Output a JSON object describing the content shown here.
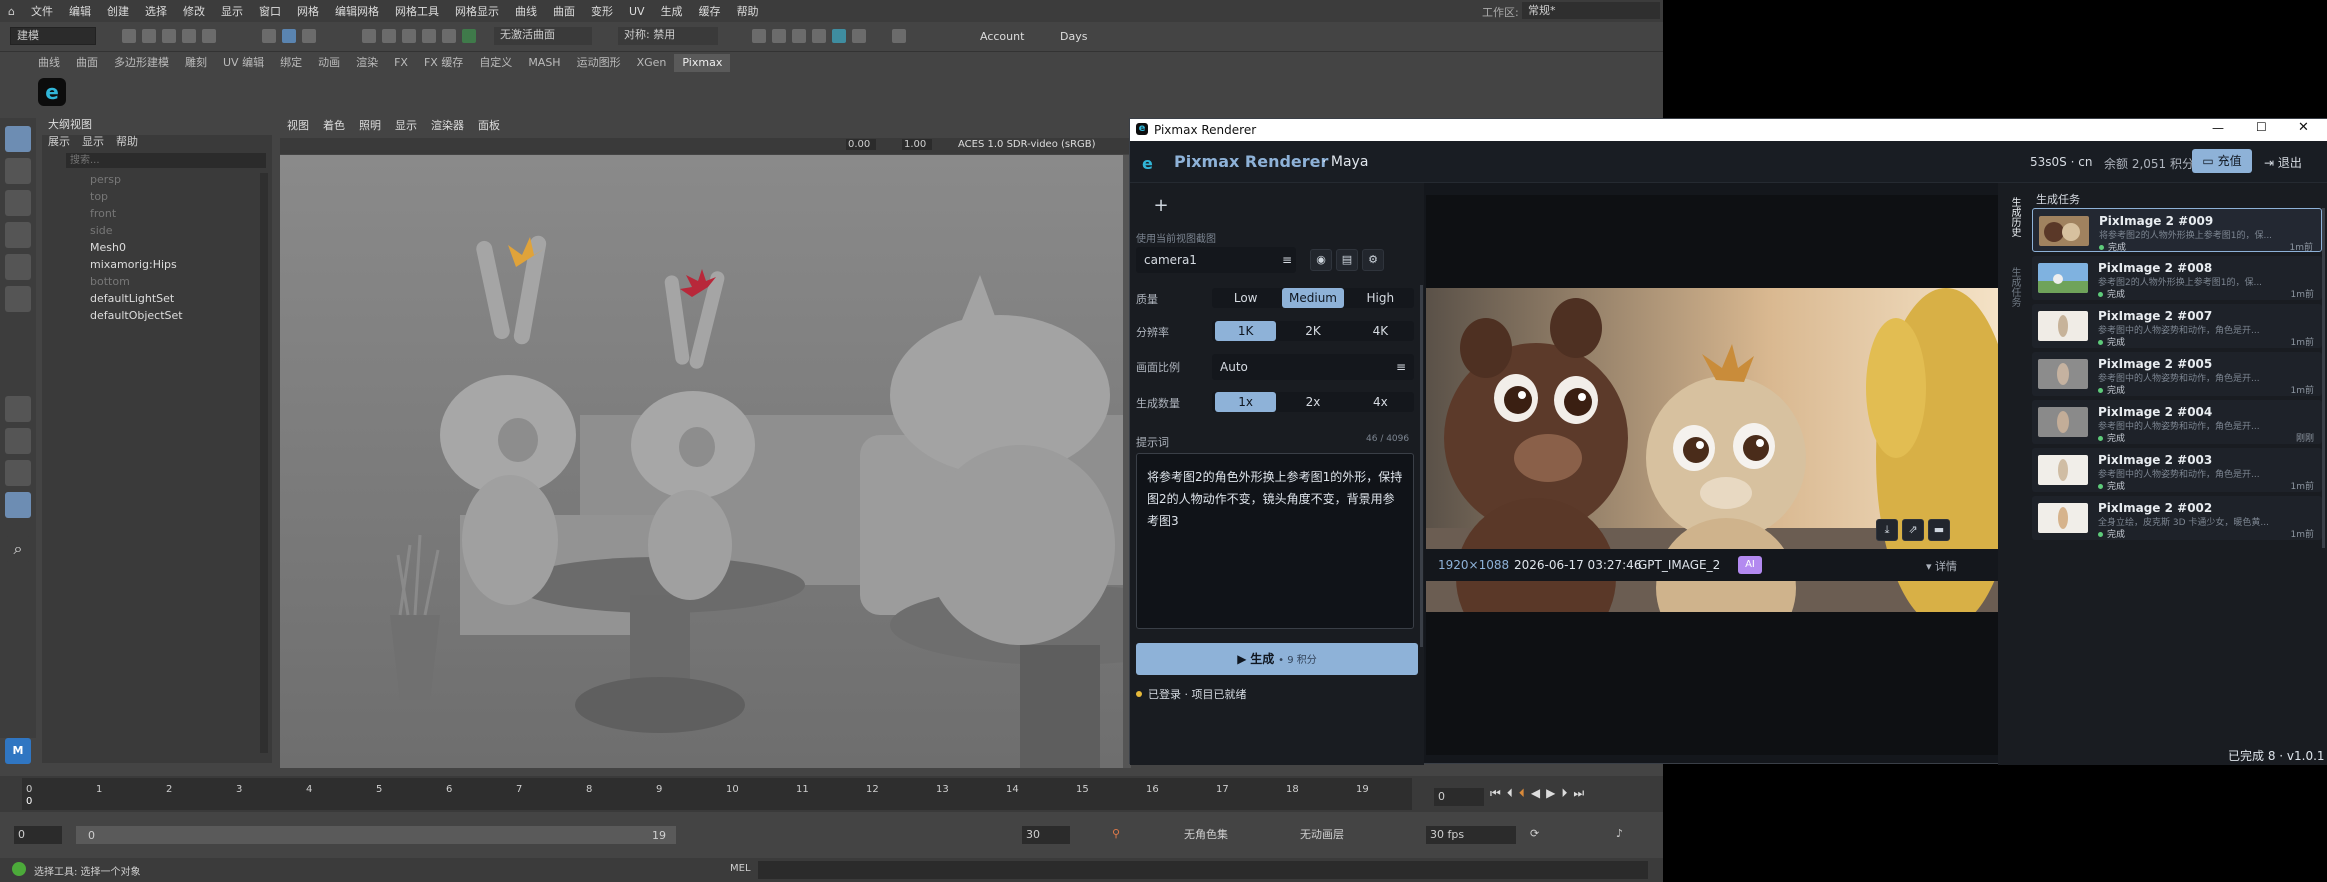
{
  "maya": {
    "menu": [
      "文件",
      "编辑",
      "创建",
      "选择",
      "修改",
      "显示",
      "窗口",
      "网格",
      "编辑网格",
      "网格工具",
      "网格显示",
      "曲线",
      "曲面",
      "变形",
      "UV",
      "生成",
      "缓存",
      "帮助"
    ],
    "workspace_label": "工作区:",
    "workspace_value": "常规*",
    "mode_select": "建模",
    "no_live_surface": "无激活曲面",
    "symmetry": "对称: 禁用",
    "account": "Account",
    "days": "Days",
    "shelf_tabs": [
      "曲线",
      "曲面",
      "多边形建模",
      "雕刻",
      "UV 编辑",
      "绑定",
      "动画",
      "渲染",
      "FX",
      "FX 缓存",
      "自定义",
      "MASH",
      "运动图形",
      "XGen",
      "Pixmax"
    ],
    "outliner": {
      "title": "大纲视图",
      "menu": [
        "展示",
        "显示",
        "帮助"
      ],
      "search_placeholder": "搜索...",
      "items": [
        {
          "label": "persp",
          "dim": true
        },
        {
          "label": "top",
          "dim": true
        },
        {
          "label": "front",
          "dim": true
        },
        {
          "label": "side",
          "dim": true
        },
        {
          "label": "Mesh0",
          "dim": false
        },
        {
          "label": "mixamorig:Hips",
          "dim": false
        },
        {
          "label": "bottom",
          "dim": true
        },
        {
          "label": "defaultLightSet",
          "dim": false
        },
        {
          "label": "defaultObjectSet",
          "dim": false
        }
      ]
    },
    "viewport": {
      "menu": [
        "视图",
        "着色",
        "照明",
        "显示",
        "渲染器",
        "面板"
      ],
      "exposure": "0.00",
      "gamma": "1.00",
      "colorspace": "ACES 1.0 SDR-video (sRGB)"
    },
    "timeline": {
      "ticks": [
        "0",
        "1",
        "2",
        "3",
        "4",
        "5",
        "6",
        "7",
        "8",
        "9",
        "10",
        "11",
        "12",
        "13",
        "14",
        "15",
        "16",
        "17",
        "18",
        "19"
      ],
      "current": "0",
      "frame_field": "0"
    },
    "range": {
      "start": "0",
      "playback_start": "0",
      "playback_end": "19",
      "end": "30",
      "no_char_set": "无角色集",
      "no_anim_layer": "无动画层",
      "fps": "30 fps"
    },
    "status": {
      "text": "选择工具: 选择一个对象",
      "mel": "MEL"
    }
  },
  "pixmax": {
    "window_title": "Pixmax Renderer",
    "header_title": "Pixmax Renderer",
    "header_sub": "· Maya",
    "user": "53s0S · cn",
    "balance": "余额 2,051 积分",
    "recharge": "充值",
    "logout": "退出",
    "ref_label": "使用当前视图截图",
    "camera": "camera1",
    "quality_label": "质量",
    "quality_options": [
      "Low",
      "Medium",
      "High"
    ],
    "quality_selected": 1,
    "resolution_label": "分辨率",
    "resolution_options": [
      "1K",
      "2K",
      "4K"
    ],
    "resolution_selected": 0,
    "aspect_label": "画面比例",
    "aspect_value": "Auto",
    "count_label": "生成数量",
    "count_options": [
      "1x",
      "2x",
      "4x"
    ],
    "count_selected": 0,
    "prompt_label": "提示词",
    "prompt_count": "46 / 4096",
    "prompt_text": "将参考图2的角色外形换上参考图1的外形，保持图2的人物动作不变，镜头角度不变，背景用参考图3",
    "generate_label": "生成",
    "generate_cost": "• 9 积分",
    "status_line": "已登录 · 项目已就绪",
    "preview_meta": {
      "size": "1920×1088",
      "time": "2026-06-17 03:27:46",
      "model": "GPT_IMAGE_2",
      "ai_badge": "AI",
      "details": "详情"
    },
    "side_tabs": [
      "生成历史",
      "生成任务"
    ],
    "tasks_title": "生成任务",
    "tasks": [
      {
        "title": "PixImage 2 #009",
        "desc": "将参考图2的人物外形换上参考图1的，保...",
        "status": "完成",
        "time": "1m前"
      },
      {
        "title": "PixImage 2 #008",
        "desc": "参考图2的人物外形换上参考图1的，保...",
        "status": "完成",
        "time": "1m前"
      },
      {
        "title": "PixImage 2 #007",
        "desc": "参考图中的人物姿势和动作，角色是开...",
        "status": "完成",
        "time": "1m前"
      },
      {
        "title": "PixImage 2 #005",
        "desc": "参考图中的人物姿势和动作，角色是开...",
        "status": "完成",
        "time": "1m前"
      },
      {
        "title": "PixImage 2 #004",
        "desc": "参考图中的人物姿势和动作，角色是开...",
        "status": "完成",
        "time": "刚刚"
      },
      {
        "title": "PixImage 2 #003",
        "desc": "参考图中的人物姿势和动作，角色是开...",
        "status": "完成",
        "time": "1m前"
      },
      {
        "title": "PixImage 2 #002",
        "desc": "全身立绘，皮克斯 3D 卡通少女，暖色黄...",
        "status": "完成",
        "time": "1m前"
      }
    ],
    "footer": "已完成 8 · v1.0.1"
  }
}
